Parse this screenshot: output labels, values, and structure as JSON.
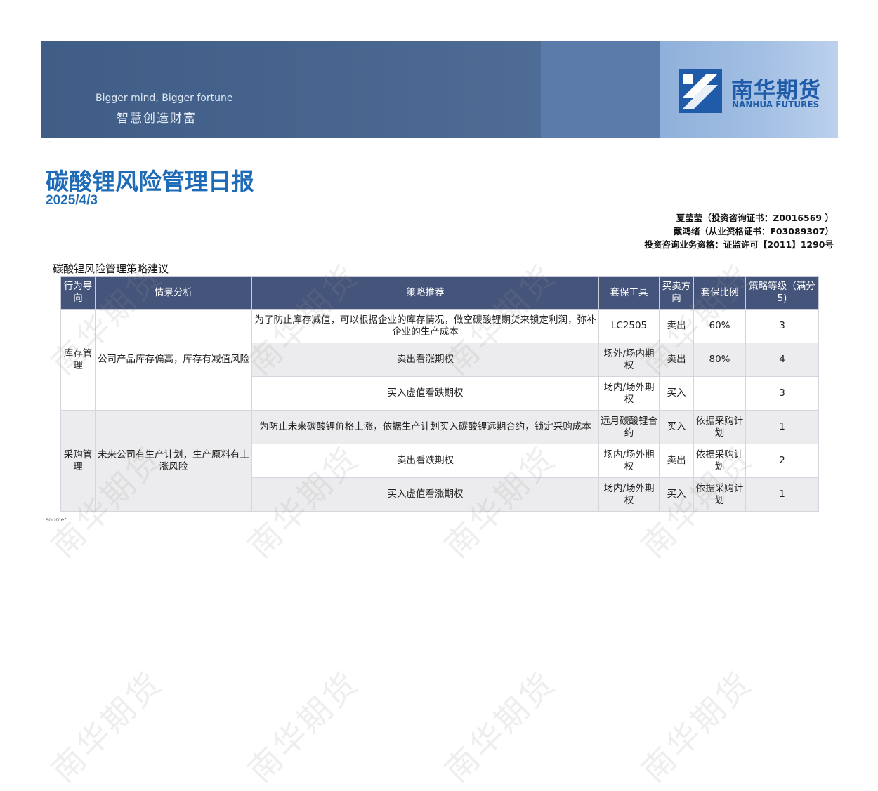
{
  "banner": {
    "slogan_en": "Bigger mind, Bigger fortune",
    "slogan_cn": "智慧创造财富",
    "logo_cn": "南华期货",
    "logo_en": "NANHUA FUTURES",
    "colors": {
      "dark": "#44628b",
      "mid": "#5b7bab",
      "light": "#a4c0e4",
      "brand": "#1f5ba8"
    }
  },
  "dot": "·",
  "report": {
    "title": "碳酸锂风险管理日报",
    "date": "2025/4/3"
  },
  "authors": [
    "夏莹莹（投资咨询证书：Z0016569 ）",
    "戴鸿绪（从业资格证书：F03089307）",
    "投资咨询业务资格：证监许可【2011】1290号"
  ],
  "section_title": "碳酸锂风险管理策略建议",
  "table": {
    "headers": [
      "行为导向",
      "情景分析",
      "策略推荐",
      "套保工具",
      "买卖方向",
      "套保比例",
      "策略等级（满分5)"
    ],
    "groups": [
      {
        "behavior": "库存管理",
        "scenario": "公司产品库存偏高，库存有减值风险",
        "rows": [
          {
            "strategy": "为了防止库存减值，可以根据企业的库存情况，做空碳酸锂期货来锁定利润，弥补企业的生产成本",
            "tool": "LC2505",
            "direction": "卖出",
            "ratio": "60%",
            "level": "3"
          },
          {
            "strategy": "卖出看涨期权",
            "tool": "场外/场内期权",
            "direction": "卖出",
            "ratio": "80%",
            "level": "4"
          },
          {
            "strategy": "买入虚值看跌期权",
            "tool": "场内/场外期权",
            "direction": "买入",
            "ratio": "",
            "level": "3"
          }
        ]
      },
      {
        "behavior": "采购管理",
        "scenario": "未来公司有生产计划，生产原料有上涨风险",
        "rows": [
          {
            "strategy": "为防止未来碳酸锂价格上涨，依据生产计划买入碳酸锂远期合约，锁定采购成本",
            "tool": "远月碳酸锂合约",
            "direction": "买入",
            "ratio": "依据采购计划",
            "level": "1"
          },
          {
            "strategy": "卖出看跌期权",
            "tool": "场内/场外期权",
            "direction": "卖出",
            "ratio": "依据采购计划",
            "level": "2"
          },
          {
            "strategy": "买入虚值看涨期权",
            "tool": "场内/场外期权",
            "direction": "买入",
            "ratio": "依据采购计划",
            "level": "1"
          }
        ]
      }
    ]
  },
  "source": "source：",
  "watermark": "南华期货"
}
